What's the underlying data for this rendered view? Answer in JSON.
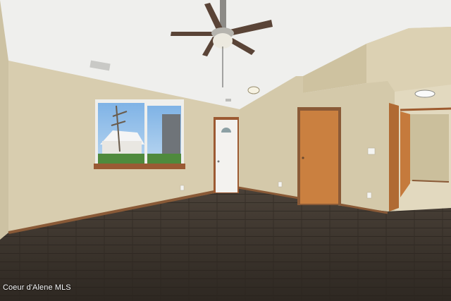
{
  "watermark": {
    "text": "Coeur d'Alene MLS"
  },
  "palette": {
    "ceiling": "#eeeeec",
    "wall": "#d7ccae",
    "wall_shadow": "#c9bd9c",
    "floor": "#3b342d",
    "baseboard": "#8a5a37",
    "door_wood": "#c57a3c",
    "entry_door": "#f3f2ef",
    "window_frame": "#efefec",
    "window_sill": "#9a5a34"
  }
}
